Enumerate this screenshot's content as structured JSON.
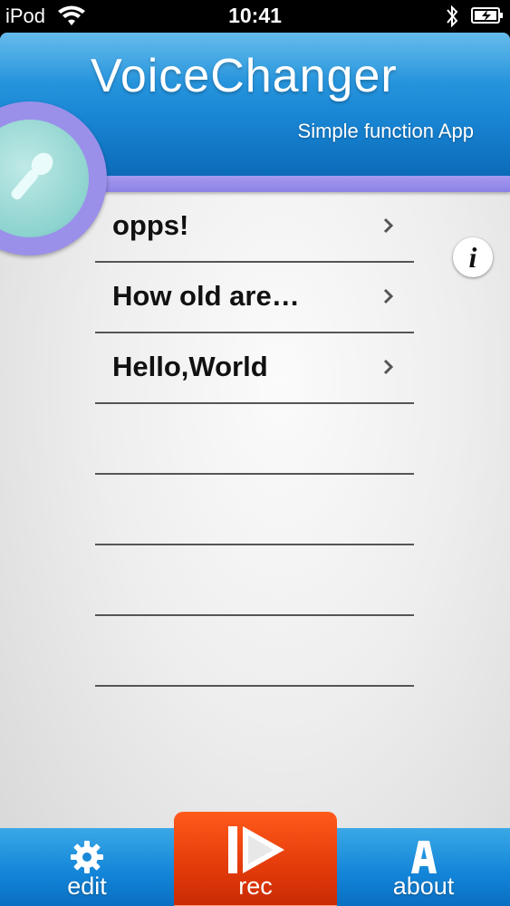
{
  "status_bar": {
    "carrier": "iPod",
    "time": "10:41"
  },
  "header": {
    "title": "VoiceChanger",
    "subtitle": "Simple function App",
    "mic_icon": "microphone-icon"
  },
  "info_button": {
    "label": "i"
  },
  "recordings": [
    {
      "label": "opps!"
    },
    {
      "label": "How old are…"
    },
    {
      "label": "Hello,World"
    },
    {
      "label": ""
    },
    {
      "label": ""
    },
    {
      "label": ""
    },
    {
      "label": ""
    }
  ],
  "tabbar": {
    "edit_label": "edit",
    "rec_label": "rec",
    "about_label": "about",
    "edit_icon": "gear-icon",
    "rec_icon": "play-record-icon",
    "about_icon": "letter-a-icon"
  },
  "colors": {
    "header_blue": "#1a88d6",
    "band_purple": "#9a90ea",
    "rec_orange": "#e33a0a",
    "mic_teal": "#8dd3cf"
  }
}
